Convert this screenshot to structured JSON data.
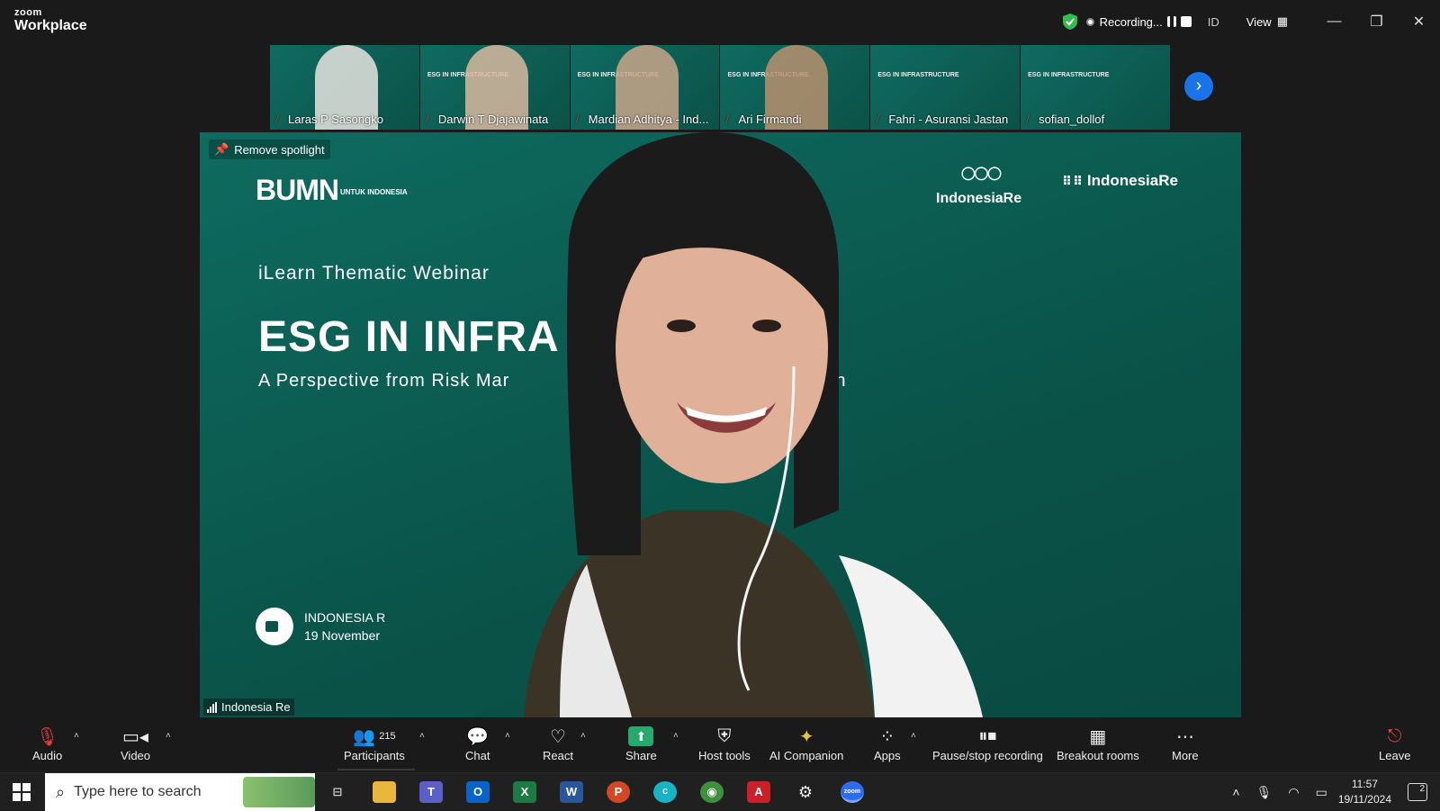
{
  "app": {
    "brand_top": "zoom",
    "brand_bottom": "Workplace"
  },
  "titlebar": {
    "recording_label": "Recording...",
    "language": "ID",
    "view_label": "View",
    "minimize": "—",
    "restore": "❐",
    "close": "✕"
  },
  "participants_strip": [
    {
      "name": "Laras P Sasongko"
    },
    {
      "name": "Darwin T Djajawinata"
    },
    {
      "name": "Mardian Adhitya - Ind..."
    },
    {
      "name": "Ari Firmandi"
    },
    {
      "name": "Fahri - Asuransi Jastan"
    },
    {
      "name": "sofian_dollof"
    }
  ],
  "thumb_slide_text": "ESG IN INFRASTRUCTURE",
  "stage": {
    "remove_spotlight": "Remove spotlight",
    "slide": {
      "bumn_logo": "BUMN",
      "bumn_tag": "UNTUK INDONESIA",
      "indonesiare_logo": "IndonesiaRe",
      "indonesiare_institute": "IndonesiaRe",
      "subtitle": "iLearn Thematic Webinar",
      "title": "ESG IN INFRA",
      "tagline_left": "A Perspective from Risk Mar",
      "tagline_right": "on",
      "brand_name": "INDONESIA R",
      "brand_date": "19 November"
    },
    "speaker_label": "Indonesia Re"
  },
  "toolbar": {
    "audio": "Audio",
    "video": "Video",
    "participants": "Participants",
    "participants_count": "215",
    "chat": "Chat",
    "react": "React",
    "share": "Share",
    "host_tools": "Host tools",
    "ai_companion": "AI Companion",
    "apps": "Apps",
    "pause_stop": "Pause/stop recording",
    "breakout": "Breakout rooms",
    "more": "More",
    "leave": "Leave"
  },
  "taskbar": {
    "search_placeholder": "Type here to search",
    "time": "11:57",
    "date": "19/11/2024",
    "notifications": "2"
  },
  "colors": {
    "accent_blue": "#1a73e8",
    "share_green": "#26a96c",
    "stage_teal": "#0e6b5f",
    "leave_red": "#e04040"
  }
}
